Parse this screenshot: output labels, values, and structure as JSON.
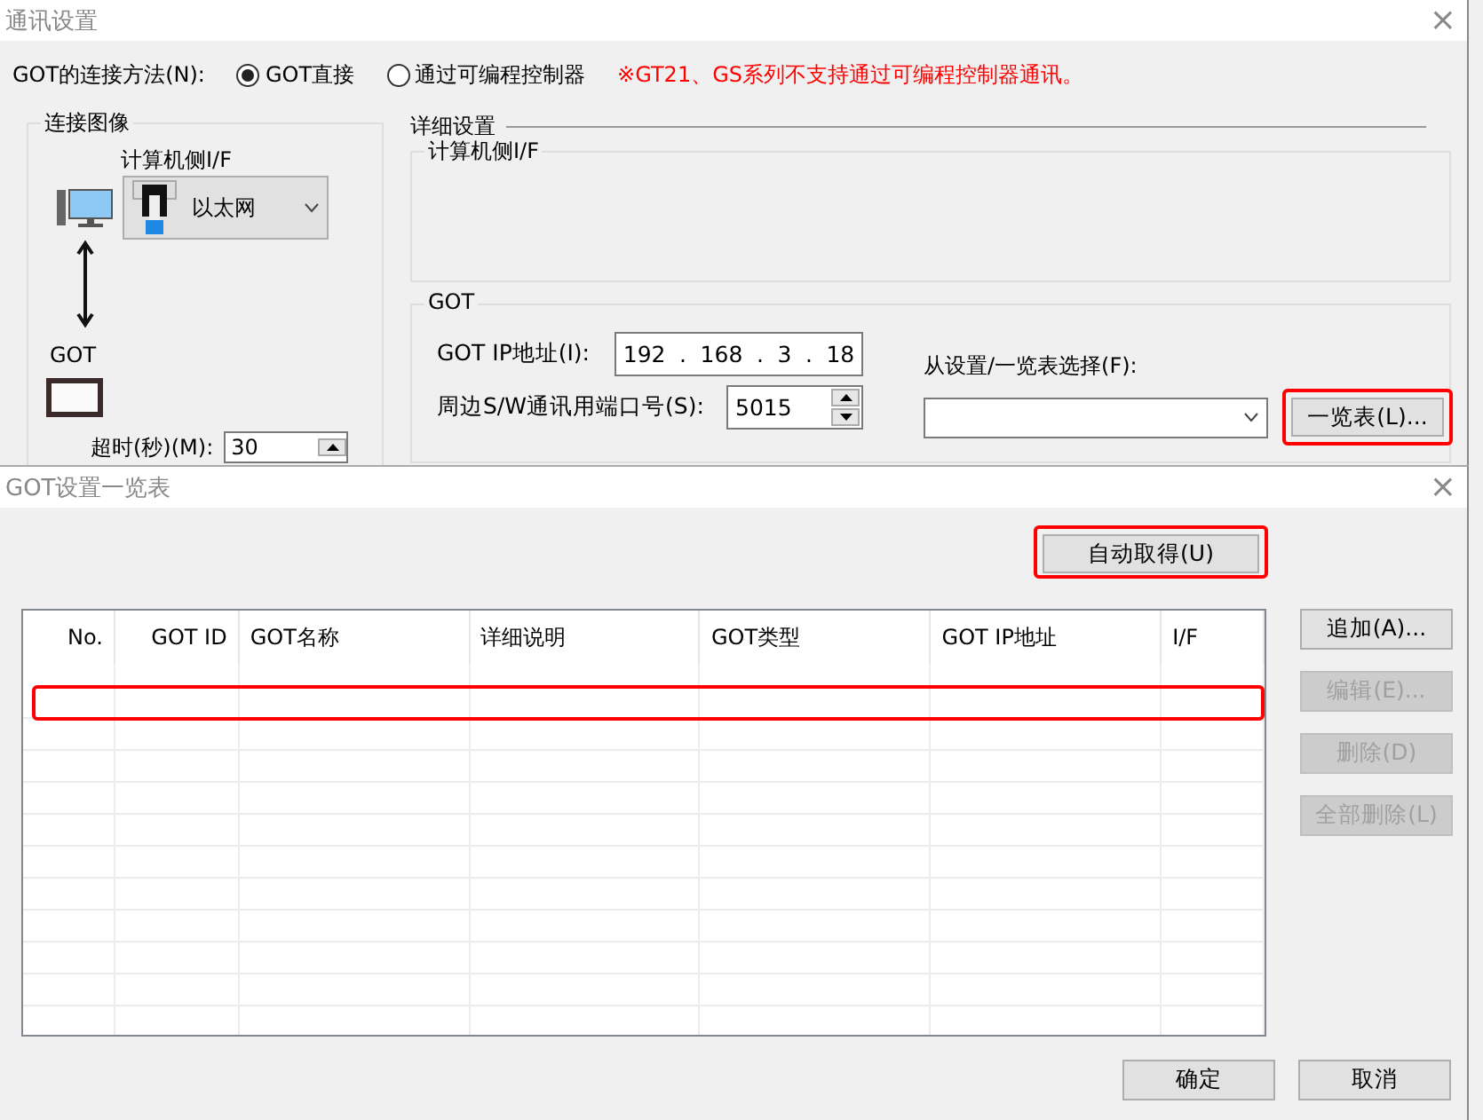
{
  "main_dialog": {
    "title": "通讯设置",
    "close": "×",
    "connection_method": {
      "label": "GOT的连接方法(N):",
      "options": [
        {
          "label": "GOT直接",
          "selected": true
        },
        {
          "label": "通过可编程控制器",
          "selected": false
        }
      ],
      "note": "※GT21、GS系列不支持通过可编程控制器通讯。"
    },
    "connection_image": {
      "title": "连接图像",
      "pc_if_label": "计算机侧I/F",
      "pc_if_value": "以太网",
      "got_label": "GOT",
      "timeout_label": "超时(秒)(M):",
      "timeout_value": "30"
    },
    "detail": {
      "title": "详细设置",
      "pc_if_group": "计算机侧I/F",
      "got_group": {
        "title": "GOT",
        "ip_label": "GOT IP地址(I):",
        "ip_octets": [
          "192",
          "168",
          "3",
          "18"
        ],
        "ip_separator": ".",
        "port_label": "周边S/W通讯用端口号(S):",
        "port_value": "5015",
        "select_label": "从设置/一览表选择(F):",
        "list_button": "一览表(L)..."
      }
    }
  },
  "list_dialog": {
    "title": "GOT设置一览表",
    "close": "×",
    "auto_button": "自动取得(U)",
    "table": {
      "columns": [
        "No.",
        "GOT ID",
        "GOT名称",
        "详细说明",
        "GOT类型",
        "GOT IP地址",
        "I/F"
      ]
    },
    "side_buttons": [
      {
        "label": "追加(A)...",
        "disabled": false
      },
      {
        "label": "编辑(E)...",
        "disabled": true
      },
      {
        "label": "删除(D)",
        "disabled": true
      },
      {
        "label": "全部删除(L)",
        "disabled": true
      }
    ],
    "footer_buttons": [
      "确定",
      "取消"
    ]
  }
}
